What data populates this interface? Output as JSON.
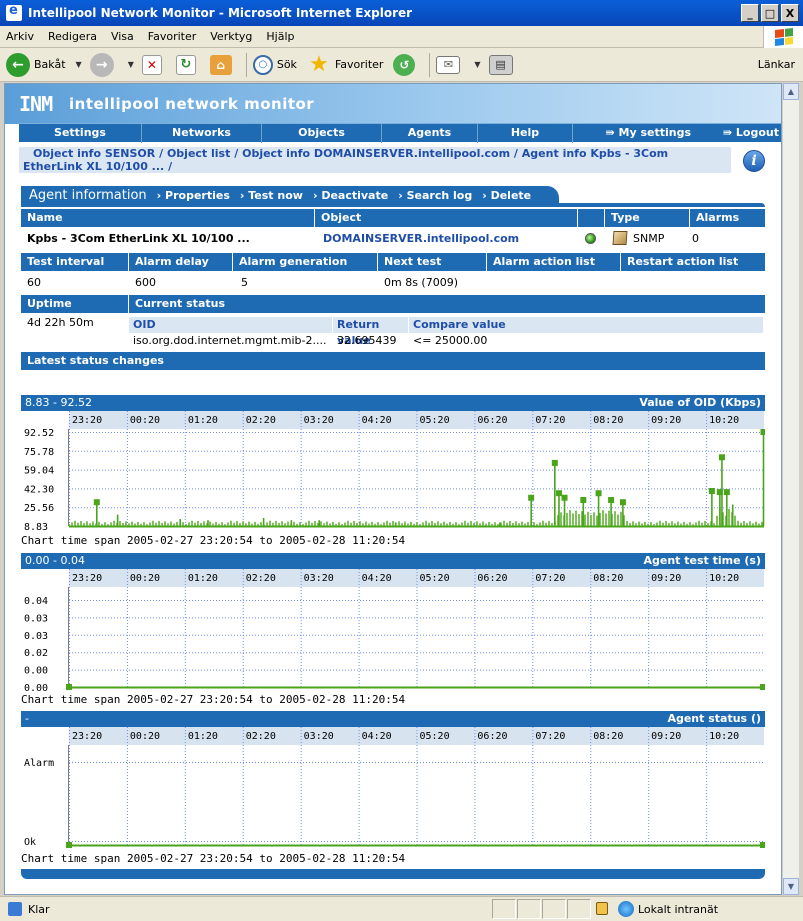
{
  "window": {
    "title": "Intellipool Network Monitor - Microsoft Internet Explorer",
    "controls": [
      "_",
      "□",
      "X"
    ]
  },
  "menu": [
    "Arkiv",
    "Redigera",
    "Visa",
    "Favoriter",
    "Verktyg",
    "Hjälp"
  ],
  "toolbar": {
    "back": "Bakåt",
    "search": "Sök",
    "favorites": "Favoriter",
    "links": "Länkar"
  },
  "app": {
    "logo_mark": "INM",
    "logo_text": "intellipool network monitor",
    "nav": [
      "Settings",
      "Networks",
      "Objects",
      "Agents",
      "Help"
    ],
    "nav_right": [
      "My settings",
      "Logout"
    ],
    "breadcrumb": [
      "Object info SENSOR",
      "Object list",
      "Object info DOMAINSERVER.intellipool.com",
      "Agent info Kpbs - 3Com EtherLink XL 10/100 ..."
    ],
    "breadcrumb_sep": "/"
  },
  "agent": {
    "section_title": "Agent information",
    "actions": [
      "Properties",
      "Test now",
      "Deactivate",
      "Search log",
      "Delete"
    ],
    "headers": {
      "name": "Name",
      "object": "Object",
      "type": "Type",
      "alarms": "Alarms"
    },
    "name": "Kpbs - 3Com EtherLink XL 10/100 ...",
    "object": "DOMAINSERVER.intellipool.com",
    "type": "SNMP",
    "alarms": "0",
    "timing_headers": [
      "Test interval",
      "Alarm delay",
      "Alarm generation",
      "Next test",
      "Alarm action list",
      "Restart action list"
    ],
    "timing_values": [
      "60",
      "600",
      "5",
      "0m 8s (7009)",
      "",
      ""
    ],
    "uptime_label": "Uptime",
    "uptime": "4d 22h 50m",
    "current_status_label": "Current status",
    "status_headers": [
      "OID",
      "Return value",
      "Compare value"
    ],
    "status_values": [
      "iso.org.dod.internet.mgmt.mib-2....",
      "32.695439",
      "<= 25000.00"
    ],
    "latest_changes_label": "Latest status changes"
  },
  "chart_data": [
    {
      "type": "bar",
      "title": "Value of OID (Kbps)",
      "range_label": "8.83 - 92.52",
      "x_ticks": [
        "23:20",
        "00:20",
        "01:20",
        "02:20",
        "03:20",
        "04:20",
        "05:20",
        "06:20",
        "07:20",
        "08:20",
        "09:20",
        "10:20"
      ],
      "y_ticks": [
        "92.52",
        "75.78",
        "59.04",
        "42.30",
        "25.56",
        "8.83"
      ],
      "ylim": [
        8.83,
        92.52
      ],
      "spikes": [
        {
          "x": 0.04,
          "y": 30
        },
        {
          "x": 0.07,
          "y": 19
        },
        {
          "x": 0.16,
          "y": 15
        },
        {
          "x": 0.2,
          "y": 14
        },
        {
          "x": 0.28,
          "y": 16
        },
        {
          "x": 0.32,
          "y": 14
        },
        {
          "x": 0.36,
          "y": 14
        },
        {
          "x": 0.47,
          "y": 12
        },
        {
          "x": 0.62,
          "y": 12
        },
        {
          "x": 0.665,
          "y": 34
        },
        {
          "x": 0.699,
          "y": 65
        },
        {
          "x": 0.705,
          "y": 38
        },
        {
          "x": 0.713,
          "y": 34
        },
        {
          "x": 0.74,
          "y": 32
        },
        {
          "x": 0.762,
          "y": 38
        },
        {
          "x": 0.78,
          "y": 32
        },
        {
          "x": 0.797,
          "y": 30
        },
        {
          "x": 0.925,
          "y": 40
        },
        {
          "x": 0.9365,
          "y": 39
        },
        {
          "x": 0.9395,
          "y": 70
        },
        {
          "x": 0.9465,
          "y": 39
        },
        {
          "x": 0.955,
          "y": 28
        },
        {
          "x": 0.9993,
          "y": 92.52
        }
      ],
      "footer": "Chart time span 2005-02-27 23:20:54 to 2005-02-28 11:20:54"
    },
    {
      "type": "line",
      "title": "Agent test time (s)",
      "range_label": "0.00 - 0.04",
      "x_ticks": [
        "23:20",
        "00:20",
        "01:20",
        "02:20",
        "03:20",
        "04:20",
        "05:20",
        "06:20",
        "07:20",
        "08:20",
        "09:20",
        "10:20"
      ],
      "y_ticks": [
        "0.04",
        "0.03",
        "0.03",
        "0.02",
        "0.00",
        "0.00"
      ],
      "values": [
        0,
        0
      ],
      "footer": "Chart time span 2005-02-27 23:20:54 to 2005-02-28 11:20:54"
    },
    {
      "type": "line",
      "title": "Agent status",
      "title_suffix": "()",
      "range_label": "-",
      "x_ticks": [
        "23:20",
        "00:20",
        "01:20",
        "02:20",
        "03:20",
        "04:20",
        "05:20",
        "06:20",
        "07:20",
        "08:20",
        "09:20",
        "10:20"
      ],
      "y_ticks": [
        "Alarm",
        "Ok"
      ],
      "values": [
        "Ok",
        "Ok"
      ],
      "footer": "Chart time span 2005-02-27 23:20:54 to 2005-02-28 11:20:54"
    }
  ],
  "statusbar": {
    "text": "Klar",
    "zone": "Lokalt intranät"
  },
  "colors": {
    "header_blue": "#1f6bb3",
    "grid_blue": "#6e8ff0",
    "series_green": "#4aa51a",
    "axis_band": "#d7e3ee"
  }
}
